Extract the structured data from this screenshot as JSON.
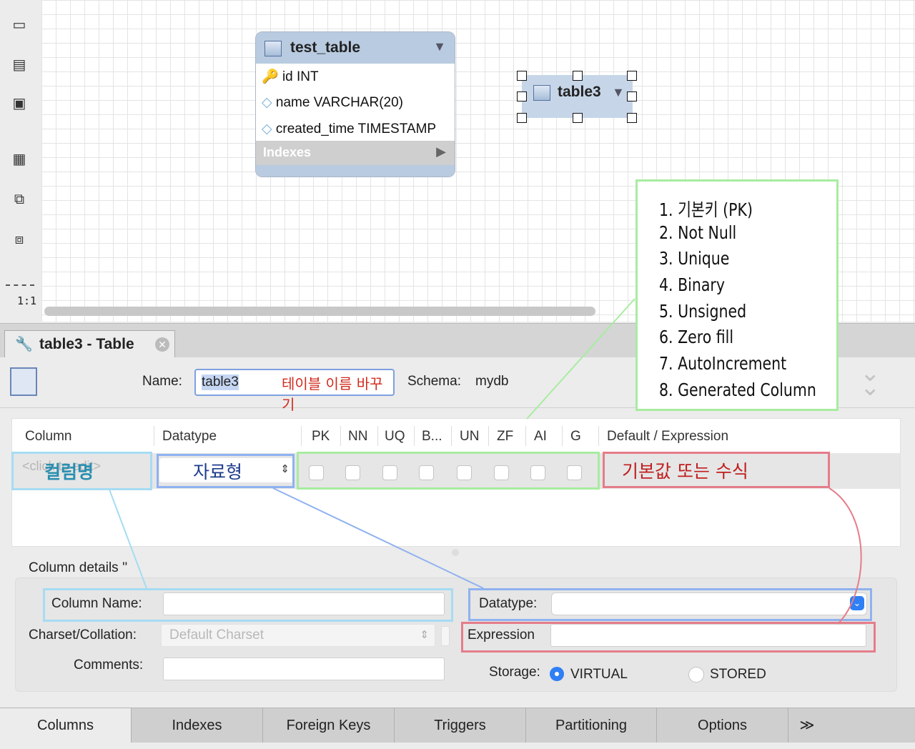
{
  "canvas": {
    "zoom": "1:1",
    "tables": [
      {
        "name": "test_table",
        "columns": [
          {
            "label": "id INT",
            "icon": "key-icon"
          },
          {
            "label": "name VARCHAR(20)",
            "icon": "diamond-icon"
          },
          {
            "label": "created_time TIMESTAMP",
            "icon": "diamond-icon"
          }
        ],
        "indexes_label": "Indexes"
      },
      {
        "name": "table3"
      }
    ]
  },
  "annotation_list": [
    "1. 기본키 (PK)",
    "2. Not Null",
    "3. Unique",
    "4. Binary",
    "5. Unsigned",
    "6. Zero fill",
    "7. AutoIncrement",
    "8. Generated Column"
  ],
  "editor": {
    "tab_title": "table3 - Table",
    "name_label": "Name:",
    "name_value": "table3",
    "name_annotation": "테이블 이름 바꾸기",
    "schema_label": "Schema:",
    "schema_value": "mydb"
  },
  "grid": {
    "headers": {
      "column": "Column",
      "datatype": "Datatype",
      "flags": [
        "PK",
        "NN",
        "UQ",
        "B...",
        "UN",
        "ZF",
        "AI",
        "G"
      ],
      "default": "Default / Expression"
    },
    "row_placeholder": "<click to edit>",
    "column_annotation": "컬럼명",
    "datatype_annotation": "자료형",
    "default_annotation": "기본값 또는 수식"
  },
  "details": {
    "title": "Column details ''",
    "column_name_label": "Column Name:",
    "charset_label": "Charset/Collation:",
    "charset_placeholder": "Default Charset",
    "comments_label": "Comments:",
    "datatype_label": "Datatype:",
    "expression_label": "Expression",
    "storage_label": "Storage:",
    "storage_options": [
      "VIRTUAL",
      "STORED"
    ],
    "storage_selected": "VIRTUAL"
  },
  "bottom_tabs": [
    "Columns",
    "Indexes",
    "Foreign Keys",
    "Triggers",
    "Partitioning",
    "Options",
    "≫"
  ],
  "colors": {
    "green": "#a8eca0",
    "blue": "#8fb2ef",
    "cyan": "#a6dcf2",
    "red": "#e57d8a",
    "table_header": "#b8cbe0"
  }
}
